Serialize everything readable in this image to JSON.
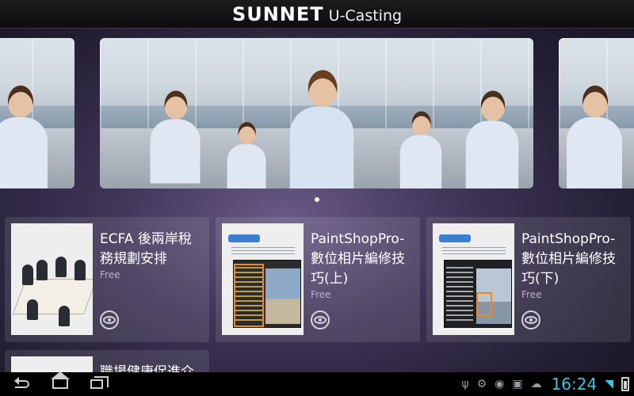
{
  "header": {
    "brand_main": "SUNNET",
    "brand_sub": "U-Casting"
  },
  "carousel": {
    "slide_count": 1,
    "active_slide": 1
  },
  "courses": [
    {
      "title": "ECFA 後兩岸稅務規劃安排",
      "price": "Free",
      "thumb": "meeting-photo"
    },
    {
      "title": "PaintShopPro-數位相片編修技巧(上)",
      "price": "Free",
      "thumb": "software-doc"
    },
    {
      "title": "PaintShopPro-數位相片編修技巧(下)",
      "price": "Free",
      "thumb": "software-doc"
    },
    {
      "title": "職場健康促進介",
      "price": "",
      "thumb": "health-banner"
    }
  ],
  "status_bar": {
    "time": "16:24",
    "icons": [
      "usb-icon",
      "android-debug-icon",
      "sync-icon",
      "image-icon",
      "upload-icon",
      "wifi-icon",
      "battery-icon"
    ]
  },
  "nav": {
    "buttons": [
      "back",
      "home",
      "recent-apps"
    ]
  },
  "colors": {
    "clock": "#35c6e8",
    "background_center": "#6a5a86",
    "background_edge": "#15121f"
  }
}
